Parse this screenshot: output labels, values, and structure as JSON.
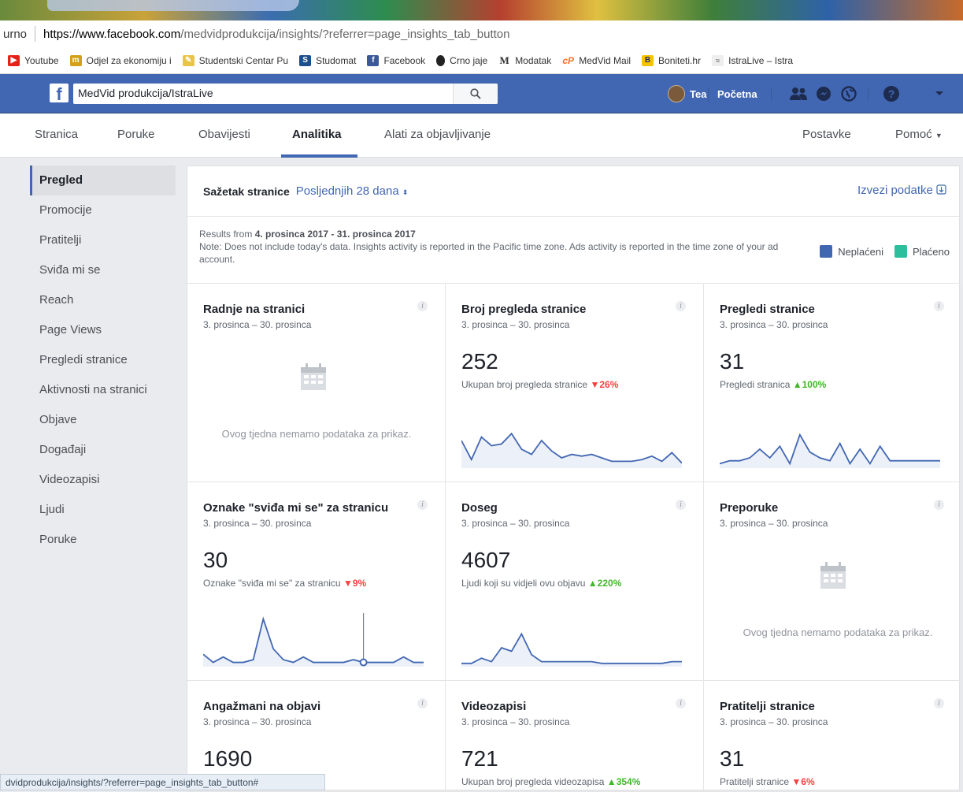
{
  "browser": {
    "url_prefix": "urno",
    "url_host": "https://www.facebook.com",
    "url_path": "/medvidprodukcija/insights/?referrer=page_insights_tab_button",
    "bookmarks": [
      {
        "label": "Youtube",
        "icon": "youtube-icon",
        "color": "#e62117"
      },
      {
        "label": "Odjel za ekonomiju i",
        "icon": "unipu-icon",
        "color": "#d4a017"
      },
      {
        "label": "Studentski Centar Pu",
        "icon": "studentski-centar-icon",
        "color": "#e8c547"
      },
      {
        "label": "Studomat",
        "icon": "studomat-icon",
        "color": "#1c4f8c"
      },
      {
        "label": "Facebook",
        "icon": "facebook-icon",
        "color": "#3b5998"
      },
      {
        "label": "Crno jaje",
        "icon": "egg-icon",
        "color": "#222222"
      },
      {
        "label": "Modatak",
        "icon": "modatak-icon",
        "color": "#333333"
      },
      {
        "label": "MedVid Mail",
        "icon": "cpanel-icon",
        "color": "#ff6c2c"
      },
      {
        "label": "Boniteti.hr",
        "icon": "boniteti-icon",
        "color": "#f5c400"
      },
      {
        "label": "IstraLive – Istra",
        "icon": "istralive-icon",
        "color": "#7a7a7a"
      }
    ]
  },
  "fb": {
    "search_value": "MedVid produkcija/IstraLive",
    "user": "Tea",
    "home": "Početna"
  },
  "page_tabs": {
    "stranica": "Stranica",
    "poruke": "Poruke",
    "obavijesti": "Obavijesti",
    "analitika": "Analitika",
    "alati": "Alati za objavljivanje",
    "postavke": "Postavke",
    "pomoc": "Pomoć"
  },
  "sidebar": {
    "items": [
      "Pregled",
      "Promocije",
      "Pratitelji",
      "Sviđa mi se",
      "Reach",
      "Page Views",
      "Pregledi stranice",
      "Aktivnosti na stranici",
      "Objave",
      "Događaji",
      "Videozapisi",
      "Ljudi",
      "Poruke"
    ]
  },
  "summary": {
    "title": "Sažetak stranice",
    "range": "Posljednjih 28 dana",
    "export": "Izvezi podatke",
    "results_prefix": "Results from",
    "results_range": "4. prosinca 2017 - 31. prosinca 2017",
    "note": "Note: Does not include today's data. Insights activity is reported in the Pacific time zone. Ads activity is reported in the time zone of your ad account.",
    "legend_unpaid": "Neplaćeni",
    "legend_paid": "Plaćeno",
    "color_unpaid": "#4267b2",
    "color_paid": "#2bbf9e"
  },
  "cards": [
    {
      "title": "Radnje na stranici",
      "date": "3. prosinca – 30. prosinca",
      "empty": "Ovog tjedna nemamo podataka za prikaz."
    },
    {
      "title": "Broj pregleda stranice",
      "date": "3. prosinca – 30. prosinca",
      "value": "252",
      "sub": "Ukupan broj pregleda stranice",
      "change": "26%",
      "trend": "down"
    },
    {
      "title": "Pregledi stranice",
      "date": "3. prosinca – 30. prosinca",
      "value": "31",
      "sub": "Pregledi stranica",
      "change": "100%",
      "trend": "up"
    },
    {
      "title": "Oznake \"sviđa mi se\" za stranicu",
      "date": "3. prosinca – 30. prosinca",
      "value": "30",
      "sub": "Oznake \"sviđa mi se\" za stranicu",
      "change": "9%",
      "trend": "down"
    },
    {
      "title": "Doseg",
      "date": "3. prosinca – 30. prosinca",
      "value": "4607",
      "sub": "Ljudi koji su vidjeli ovu objavu",
      "change": "220%",
      "trend": "up"
    },
    {
      "title": "Preporuke",
      "date": "3. prosinca – 30. prosinca",
      "empty": "Ovog tjedna nemamo podataka za prikaz."
    },
    {
      "title": "Angažmani na objavi",
      "date": "3. prosinca – 30. prosinca",
      "value": "1690"
    },
    {
      "title": "Videozapisi",
      "date": "3. prosinca – 30. prosinca",
      "value": "721",
      "sub": "Ukupan broj pregleda videozapisa",
      "change": "354%",
      "trend": "up"
    },
    {
      "title": "Pratitelji stranice",
      "date": "3. prosinca – 30. prosinca",
      "value": "31",
      "sub": "Pratitelji stranice",
      "change": "6%",
      "trend": "down"
    }
  ],
  "sparklines": {
    "page_views": [
      30,
      8,
      34,
      24,
      26,
      38,
      20,
      14,
      30,
      18,
      10,
      14,
      12,
      14,
      10,
      6,
      6,
      6,
      8,
      12,
      6,
      16,
      4
    ],
    "page_previews": [
      2,
      4,
      4,
      6,
      12,
      6,
      14,
      2,
      22,
      10,
      6,
      4,
      16,
      2,
      12,
      2,
      14,
      4,
      4,
      4,
      4,
      4,
      4
    ],
    "likes": [
      8,
      2,
      6,
      2,
      2,
      4,
      34,
      12,
      4,
      2,
      6,
      2,
      2,
      2,
      2,
      4,
      2,
      2,
      2,
      2,
      6,
      2,
      2
    ],
    "reach": [
      1,
      1,
      4,
      2,
      10,
      8,
      18,
      6,
      2,
      2,
      2,
      2,
      2,
      2,
      1,
      1,
      1,
      1,
      1,
      1,
      1,
      2,
      2
    ]
  },
  "status_bar": "dvidprodukcija/insights/?referrer=page_insights_tab_button#"
}
